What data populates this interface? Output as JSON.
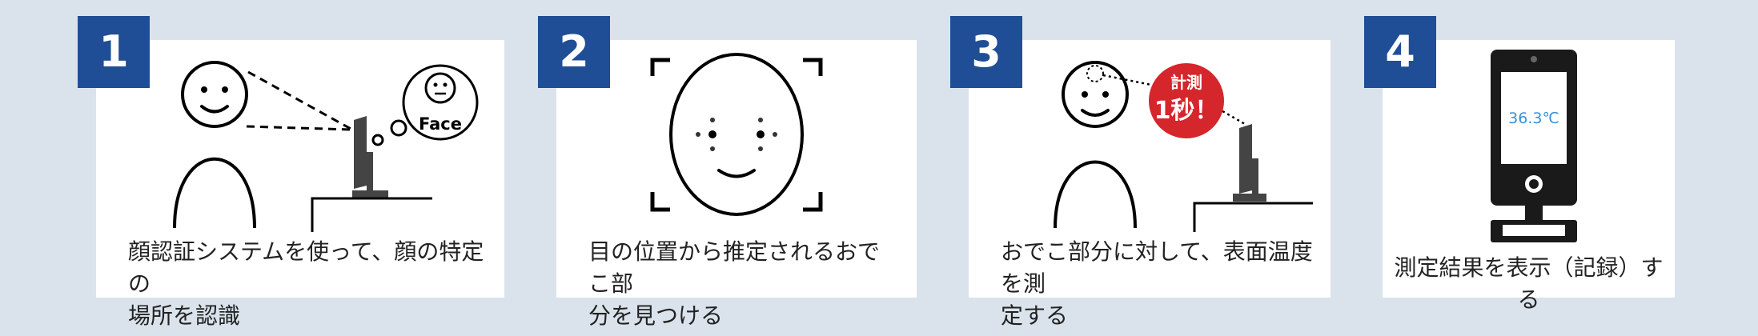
{
  "steps": [
    {
      "number": "1",
      "caption_line1": "顔認証システムを使って、顔の特定の",
      "caption_line2": "場所を認識",
      "face_label": "Face"
    },
    {
      "number": "2",
      "caption_line1": "目の位置から推定されるおでこ部",
      "caption_line2": "分を見つける"
    },
    {
      "number": "3",
      "caption_line1": "おでこ部分に対して、表面温度を測",
      "caption_line2": "定する",
      "bubble_line1": "計測",
      "bubble_line2": "1秒！"
    },
    {
      "number": "4",
      "caption": "測定結果を表示（記録）する",
      "temperature": "36.3℃"
    }
  ],
  "colors": {
    "badge": "#1f4e96",
    "bubble": "#d4262b",
    "screen_text": "#3a8fd8"
  }
}
